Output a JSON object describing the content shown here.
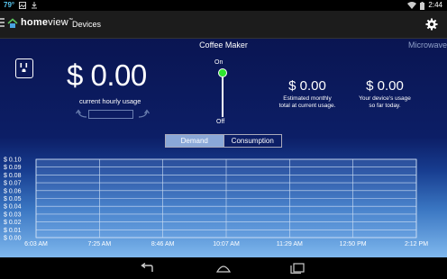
{
  "status_bar": {
    "temperature": "79°",
    "time": "2:44"
  },
  "action_bar": {
    "brand_home": "home",
    "brand_view": "view",
    "trademark": "™",
    "dash": "-",
    "title": "Devices"
  },
  "device": {
    "name": "Coffee Maker",
    "next_device": "Microwave"
  },
  "usage": {
    "hourly_value": "$ 0.00",
    "hourly_label": "current hourly usage"
  },
  "switch": {
    "on_label": "On",
    "off_label": "Off",
    "state": "on",
    "on_color": "#2ee62e"
  },
  "stats": {
    "monthly_value": "$ 0.00",
    "monthly_label_line1": "Estimated monthly",
    "monthly_label_line2": "total at current usage.",
    "sofar_value": "$ 0.00",
    "sofar_label_line1": "Your device's usage",
    "sofar_label_line2": "so far today."
  },
  "toggle": {
    "demand_label": "Demand",
    "consumption_label": "Consumption",
    "selected": "Demand"
  },
  "chart_data": {
    "type": "line",
    "y_ticks": [
      "$ 0.10",
      "$ 0.09",
      "$ 0.08",
      "$ 0.07",
      "$ 0.06",
      "$ 0.05",
      "$ 0.04",
      "$ 0.03",
      "$ 0.02",
      "$ 0.01",
      "$ 0.00"
    ],
    "x_ticks": [
      "6:03 AM",
      "7:25 AM",
      "8:46 AM",
      "10:07 AM",
      "11:29 AM",
      "12:50 PM",
      "2:12 PM"
    ],
    "ylim": [
      0,
      0.1
    ],
    "grid": true,
    "series": []
  },
  "colors": {
    "accent_green": "#2ee62e",
    "toggle_selected": "#8aa8d8",
    "background_top": "#0a1552"
  }
}
